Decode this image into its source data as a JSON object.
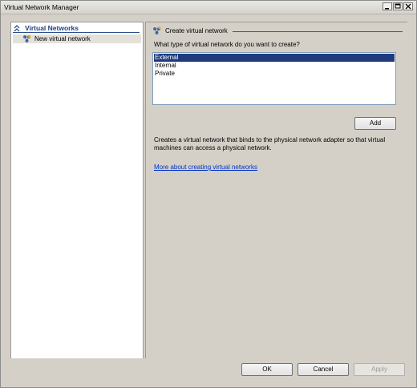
{
  "window": {
    "title": "Virtual Network Manager"
  },
  "sidebar": {
    "section_title": "Virtual Networks",
    "items": [
      {
        "label": "New virtual network"
      }
    ]
  },
  "main": {
    "group_title": "Create virtual network",
    "question": "What type of virtual network do you want to create?",
    "network_types": [
      {
        "label": "External"
      },
      {
        "label": "Internal"
      },
      {
        "label": "Private"
      }
    ],
    "selected_type": "External",
    "add_label": "Add",
    "description": "Creates a virtual network that binds to the physical network adapter so that virtual machines can access a physical network.",
    "help_link": "More about creating virtual networks"
  },
  "footer": {
    "ok_label": "OK",
    "cancel_label": "Cancel",
    "apply_label": "Apply"
  },
  "colors": {
    "selection": "#1f3b7c",
    "section_title": "#1c3f86",
    "link": "#0033cc",
    "background": "#d4d0c8"
  }
}
